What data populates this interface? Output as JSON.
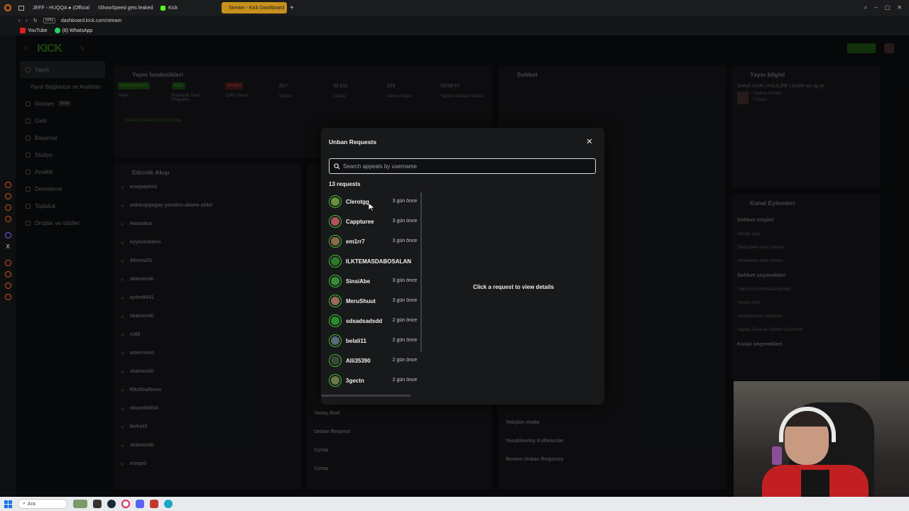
{
  "browser": {
    "tabs": [
      {
        "label": "JEFF - HUQQA ● (Official",
        "active": false
      },
      {
        "label": "IShowSpeed gets leaked",
        "active": false
      },
      {
        "label": "Kick",
        "active": false
      },
      {
        "label": "Stream - Kick Dashboard",
        "active": true
      }
    ],
    "url": "dashboard.kick.com/stream",
    "vpn_label": "VPN",
    "bookmarks": [
      {
        "label": "YouTube"
      },
      {
        "label": "(8) WhatsApp"
      }
    ]
  },
  "dashboard": {
    "logo": "KICK",
    "sidebar": [
      {
        "label": "Yayın",
        "selected": true
      },
      {
        "label": "Yayın Bağlantısı ve Anahtarı",
        "selected": false
      },
      {
        "label": "Reklam",
        "badge": "Beta",
        "selected": false
      },
      {
        "label": "Gelir",
        "selected": false
      },
      {
        "label": "Başarılar",
        "selected": false
      },
      {
        "label": "Stüdyo",
        "selected": false
      },
      {
        "label": "Analitik",
        "selected": false
      },
      {
        "label": "Denetleme",
        "selected": false
      },
      {
        "label": "Topluluk",
        "selected": false
      },
      {
        "label": "Droplar ve ödüller",
        "selected": false
      }
    ],
    "stats_panel": {
      "title": "Yayın İstatistikleri",
      "items": [
        {
          "value": "DOKUNULMAZ",
          "label": "Yayın"
        },
        {
          "value": "AÇIK",
          "label": "Partnerlik Gelir Programı"
        },
        {
          "value": "KAPALI",
          "label": "Çoklu Yayın"
        },
        {
          "value": "817",
          "label": "İzleyici"
        },
        {
          "value": "30.811",
          "label": "Takipçi"
        },
        {
          "value": "323",
          "label": "Abone Sayısı"
        },
        {
          "value": "00:58:57",
          "label": "Yayının Oturum Süresi"
        }
      ],
      "status": "Stream started successfully"
    },
    "activity_panel": {
      "title": "Etkinlik Akışı",
      "rows": [
        "eraypapiniz",
        "ankarajojogay yeniden abone oldu!",
        "Hamsikar",
        "eyyorecklees",
        "Akınnu31",
        "skanovski",
        "aydın8441",
        "skanovski",
        "ru80",
        "omerrsolo",
        "skanovski",
        "f0kzfinalboss",
        "ebucehil034",
        "NefretX",
        "skanovski",
        "eroqe0"
      ]
    },
    "mod_log": {
      "rows": [
        "Yavaş Mod",
        "Unban Request",
        "Cynaz",
        "Cynaz"
      ]
    },
    "chat_panel": {
      "title": "Sohbet",
      "rows": [
        "Yetişkin modu",
        "Yasaklanmış Kullanıcılar",
        "Review Unban Requests"
      ]
    },
    "stream_info": {
      "title": "Yayın bilgisi",
      "stream_title": "SAKIP ATAR | KOLEJRP | DORP ldc lig lyt",
      "chat_mode": "Sadece Sohbet",
      "language": "Türkish"
    },
    "channel_actions": {
      "title": "Kanal Eylemleri",
      "sections": [
        {
          "heading": "Sohbet erişimi",
          "items": [
            "Hesap yaşı",
            "Takipçilere özel sohbet",
            "Abonelere özel sohbet"
          ]
        },
        {
          "heading": "Sohbet seçenekleri",
          "items": [
            "Yalnızca Emotlarla sohbet",
            "Yavaş mod",
            "Yasaklanmış kelimeler",
            "Yapay Zeka ile Sohbet Denetimi"
          ]
        },
        {
          "heading": "Kanal seçenekleri",
          "items": []
        }
      ]
    }
  },
  "modal": {
    "title": "Unban Requests",
    "search_placeholder": "Search appeals by username",
    "count_label": "13 requests",
    "requests": [
      {
        "username": "Clerotgg",
        "ago": "3 gün önce",
        "color": "#6b8f3a"
      },
      {
        "username": "Cappturee",
        "ago": "3 gün önce",
        "color": "#b0505a"
      },
      {
        "username": "em1rr7",
        "ago": "3 gün önce",
        "color": "#8a6a4a"
      },
      {
        "username": "ILKTEMASDABOSALAN",
        "ago": "",
        "color": "#2f7a2a"
      },
      {
        "username": "SinsiAbe",
        "ago": "3 gün önce",
        "color": "#3a8a3a"
      },
      {
        "username": "MeruShuut",
        "ago": "3 gün önce",
        "color": "#9a6a5a"
      },
      {
        "username": "sdsadsadsdd",
        "ago": "2 gün önce",
        "color": "#2e8c2e"
      },
      {
        "username": "belali11",
        "ago": "2 gün önce",
        "color": "#5a6a7a"
      },
      {
        "username": "Alli35390",
        "ago": "2 gün önce",
        "color": "#3a4a3a"
      },
      {
        "username": "3gectn",
        "ago": "2 gün önce",
        "color": "#6a7a4a"
      }
    ],
    "empty_detail": "Click a request to view details",
    "close_icon": "close-icon"
  },
  "taskbar": {
    "search_label": "Ara"
  }
}
